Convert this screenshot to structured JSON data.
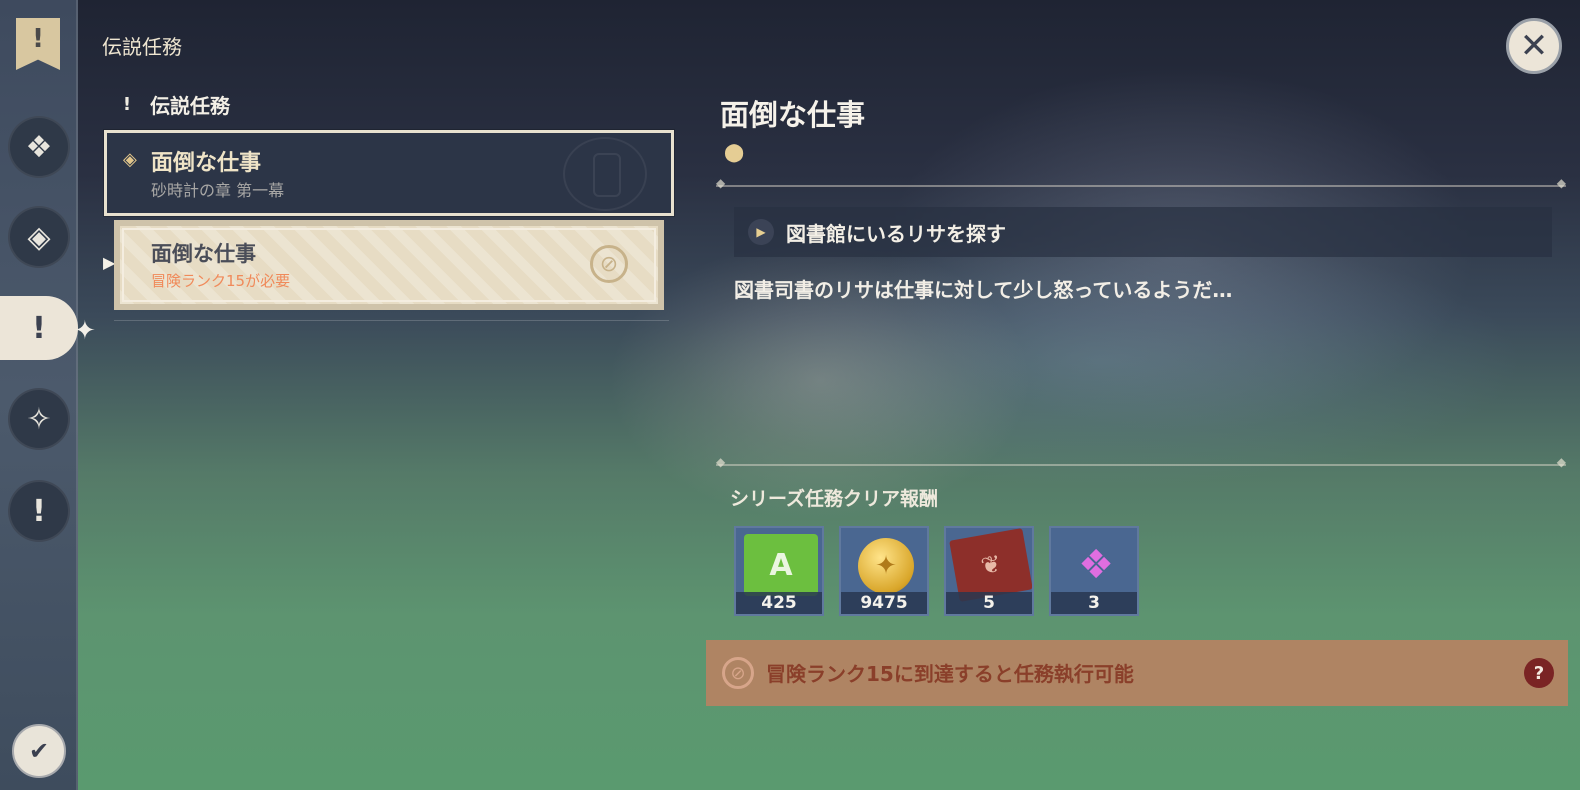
{
  "page_title": "伝説任務",
  "close_label": "✕",
  "sidebar": {
    "top_banner_icon": "quest-banner-icon",
    "items": [
      {
        "name": "nav-item-archon",
        "glyph": "❖"
      },
      {
        "name": "nav-item-story",
        "glyph": "◈"
      },
      {
        "name": "nav-item-legend",
        "glyph": "!"
      },
      {
        "name": "nav-item-world",
        "glyph": "✧"
      },
      {
        "name": "nav-item-commission",
        "glyph": "!"
      }
    ],
    "bottom_button_glyph": "✔"
  },
  "category": {
    "label": "伝説任務",
    "icon": "exclamation-icon"
  },
  "quest_list": [
    {
      "title": "面倒な仕事",
      "subtitle": "砂時計の章 第一幕",
      "selected": true
    },
    {
      "title": "面倒な仕事",
      "requirement": "冒険ランク15が必要",
      "locked": true
    }
  ],
  "detail": {
    "title": "面倒な仕事",
    "objective": "図書館にいるリサを探す",
    "description": "図書司書のリサは仕事に対して少し怒っているようだ…",
    "rewards_label": "シリーズ任務クリア報酬",
    "rewards": [
      {
        "name": "adventure-exp",
        "count": "425",
        "glyph": "A"
      },
      {
        "name": "mora",
        "count": "9475",
        "glyph": "✦"
      },
      {
        "name": "heros-wit",
        "count": "5",
        "glyph": "❦"
      },
      {
        "name": "crystal",
        "count": "3",
        "glyph": "❖"
      }
    ],
    "warning": "冒険ランク15に到達すると任務執行可能",
    "help_label": "?"
  },
  "colors": {
    "accent_gold": "#e2c68b",
    "warning_bg": "#c48060",
    "warning_text": "#8a3f2a",
    "requirement_text": "#f08a5a"
  }
}
